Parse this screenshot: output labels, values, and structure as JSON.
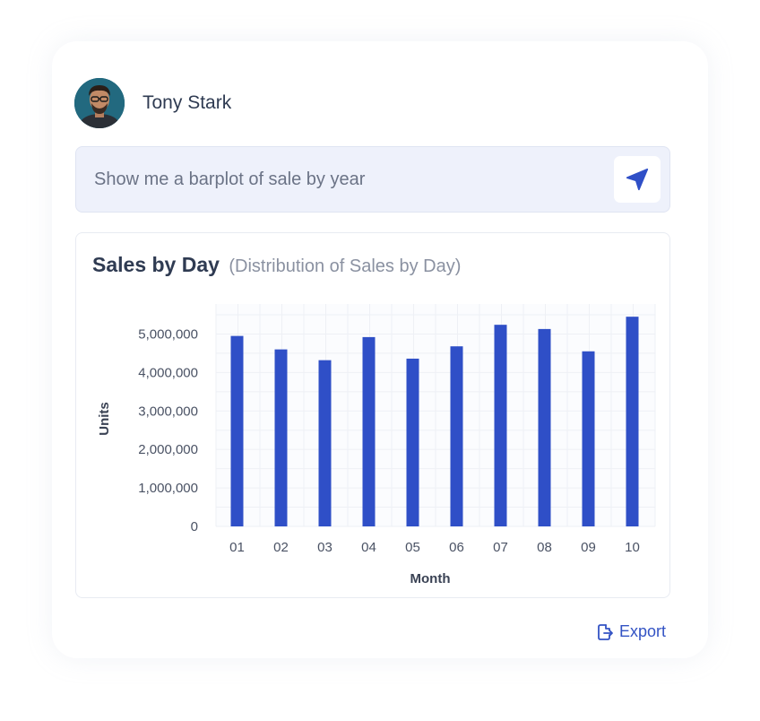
{
  "user": {
    "name": "Tony Stark"
  },
  "prompt": {
    "text": "Show me a barplot of sale by year"
  },
  "chart": {
    "title": "Sales by Day",
    "subtitle": "(Distribution of Sales by Day)"
  },
  "export": {
    "label": "Export"
  },
  "colors": {
    "accent": "#3353c4",
    "bar": "#2f4fc7"
  },
  "chart_data": {
    "type": "bar",
    "title": "Sales by Day",
    "subtitle": "(Distribution of Sales by Day)",
    "xlabel": "Month",
    "ylabel": "Units",
    "categories": [
      "01",
      "02",
      "03",
      "04",
      "05",
      "06",
      "07",
      "08",
      "09",
      "10"
    ],
    "values": [
      4950000,
      4600000,
      4320000,
      4920000,
      4360000,
      4680000,
      5240000,
      5130000,
      4550000,
      5450000
    ],
    "ylim": [
      0,
      5780000
    ],
    "yticks": [
      0,
      1000000,
      2000000,
      3000000,
      4000000,
      5000000
    ],
    "ytick_labels": [
      "0",
      "1,000,000",
      "2,000,000",
      "3,000,000",
      "4,000,000",
      "5,000,000"
    ],
    "grid": true,
    "bar_color": "#2f4fc7"
  }
}
